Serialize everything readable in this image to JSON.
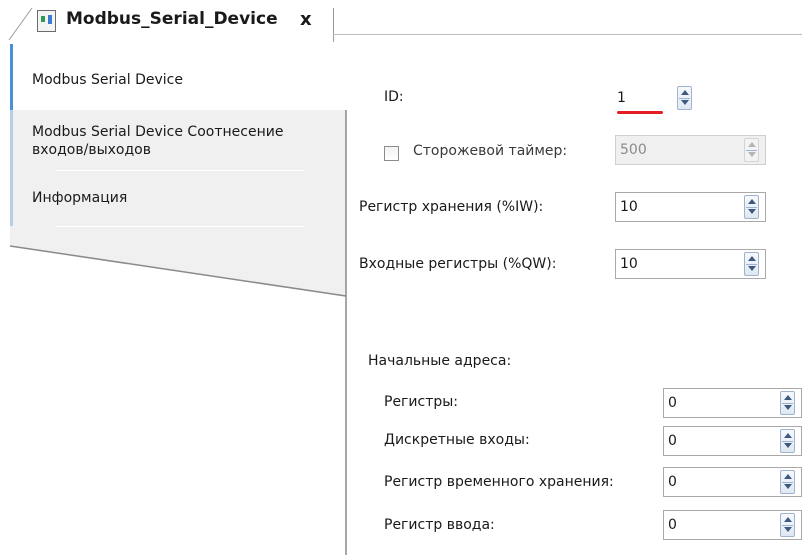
{
  "tab": {
    "title": "Modbus_Serial_Device",
    "close_glyph": "x",
    "icon": "device-icon"
  },
  "nav": {
    "items": [
      {
        "label": "Modbus Serial Device",
        "active": true
      },
      {
        "label_line1": "Modbus Serial Device Соотнесение",
        "label_line2": "входов/выходов",
        "active": false
      },
      {
        "label": "Информация",
        "active": false
      }
    ]
  },
  "form": {
    "id": {
      "label": "ID:",
      "value": "1"
    },
    "watchdog": {
      "label": "Сторожевой таймер:",
      "value": "500",
      "checked": false,
      "disabled": true
    },
    "holding_registers": {
      "label": "Регистр хранения (%IW):",
      "value": "10"
    },
    "input_registers": {
      "label": "Входные регистры (%QW):",
      "value": "10"
    },
    "start_addresses": {
      "title": "Начальные адреса:",
      "registers": {
        "label": "Регистры:",
        "value": "0"
      },
      "discrete_inputs": {
        "label": "Дискретные входы:",
        "value": "0"
      },
      "temp_holding_register": {
        "label": "Регистр временного хранения:",
        "value": "0"
      },
      "input_register": {
        "label": "Регистр ввода:",
        "value": "0"
      }
    }
  },
  "colors": {
    "active_tab_accent": "#4a90d9",
    "nav_background": "#f0f0f0",
    "highlight_mark": "#e31e24"
  }
}
